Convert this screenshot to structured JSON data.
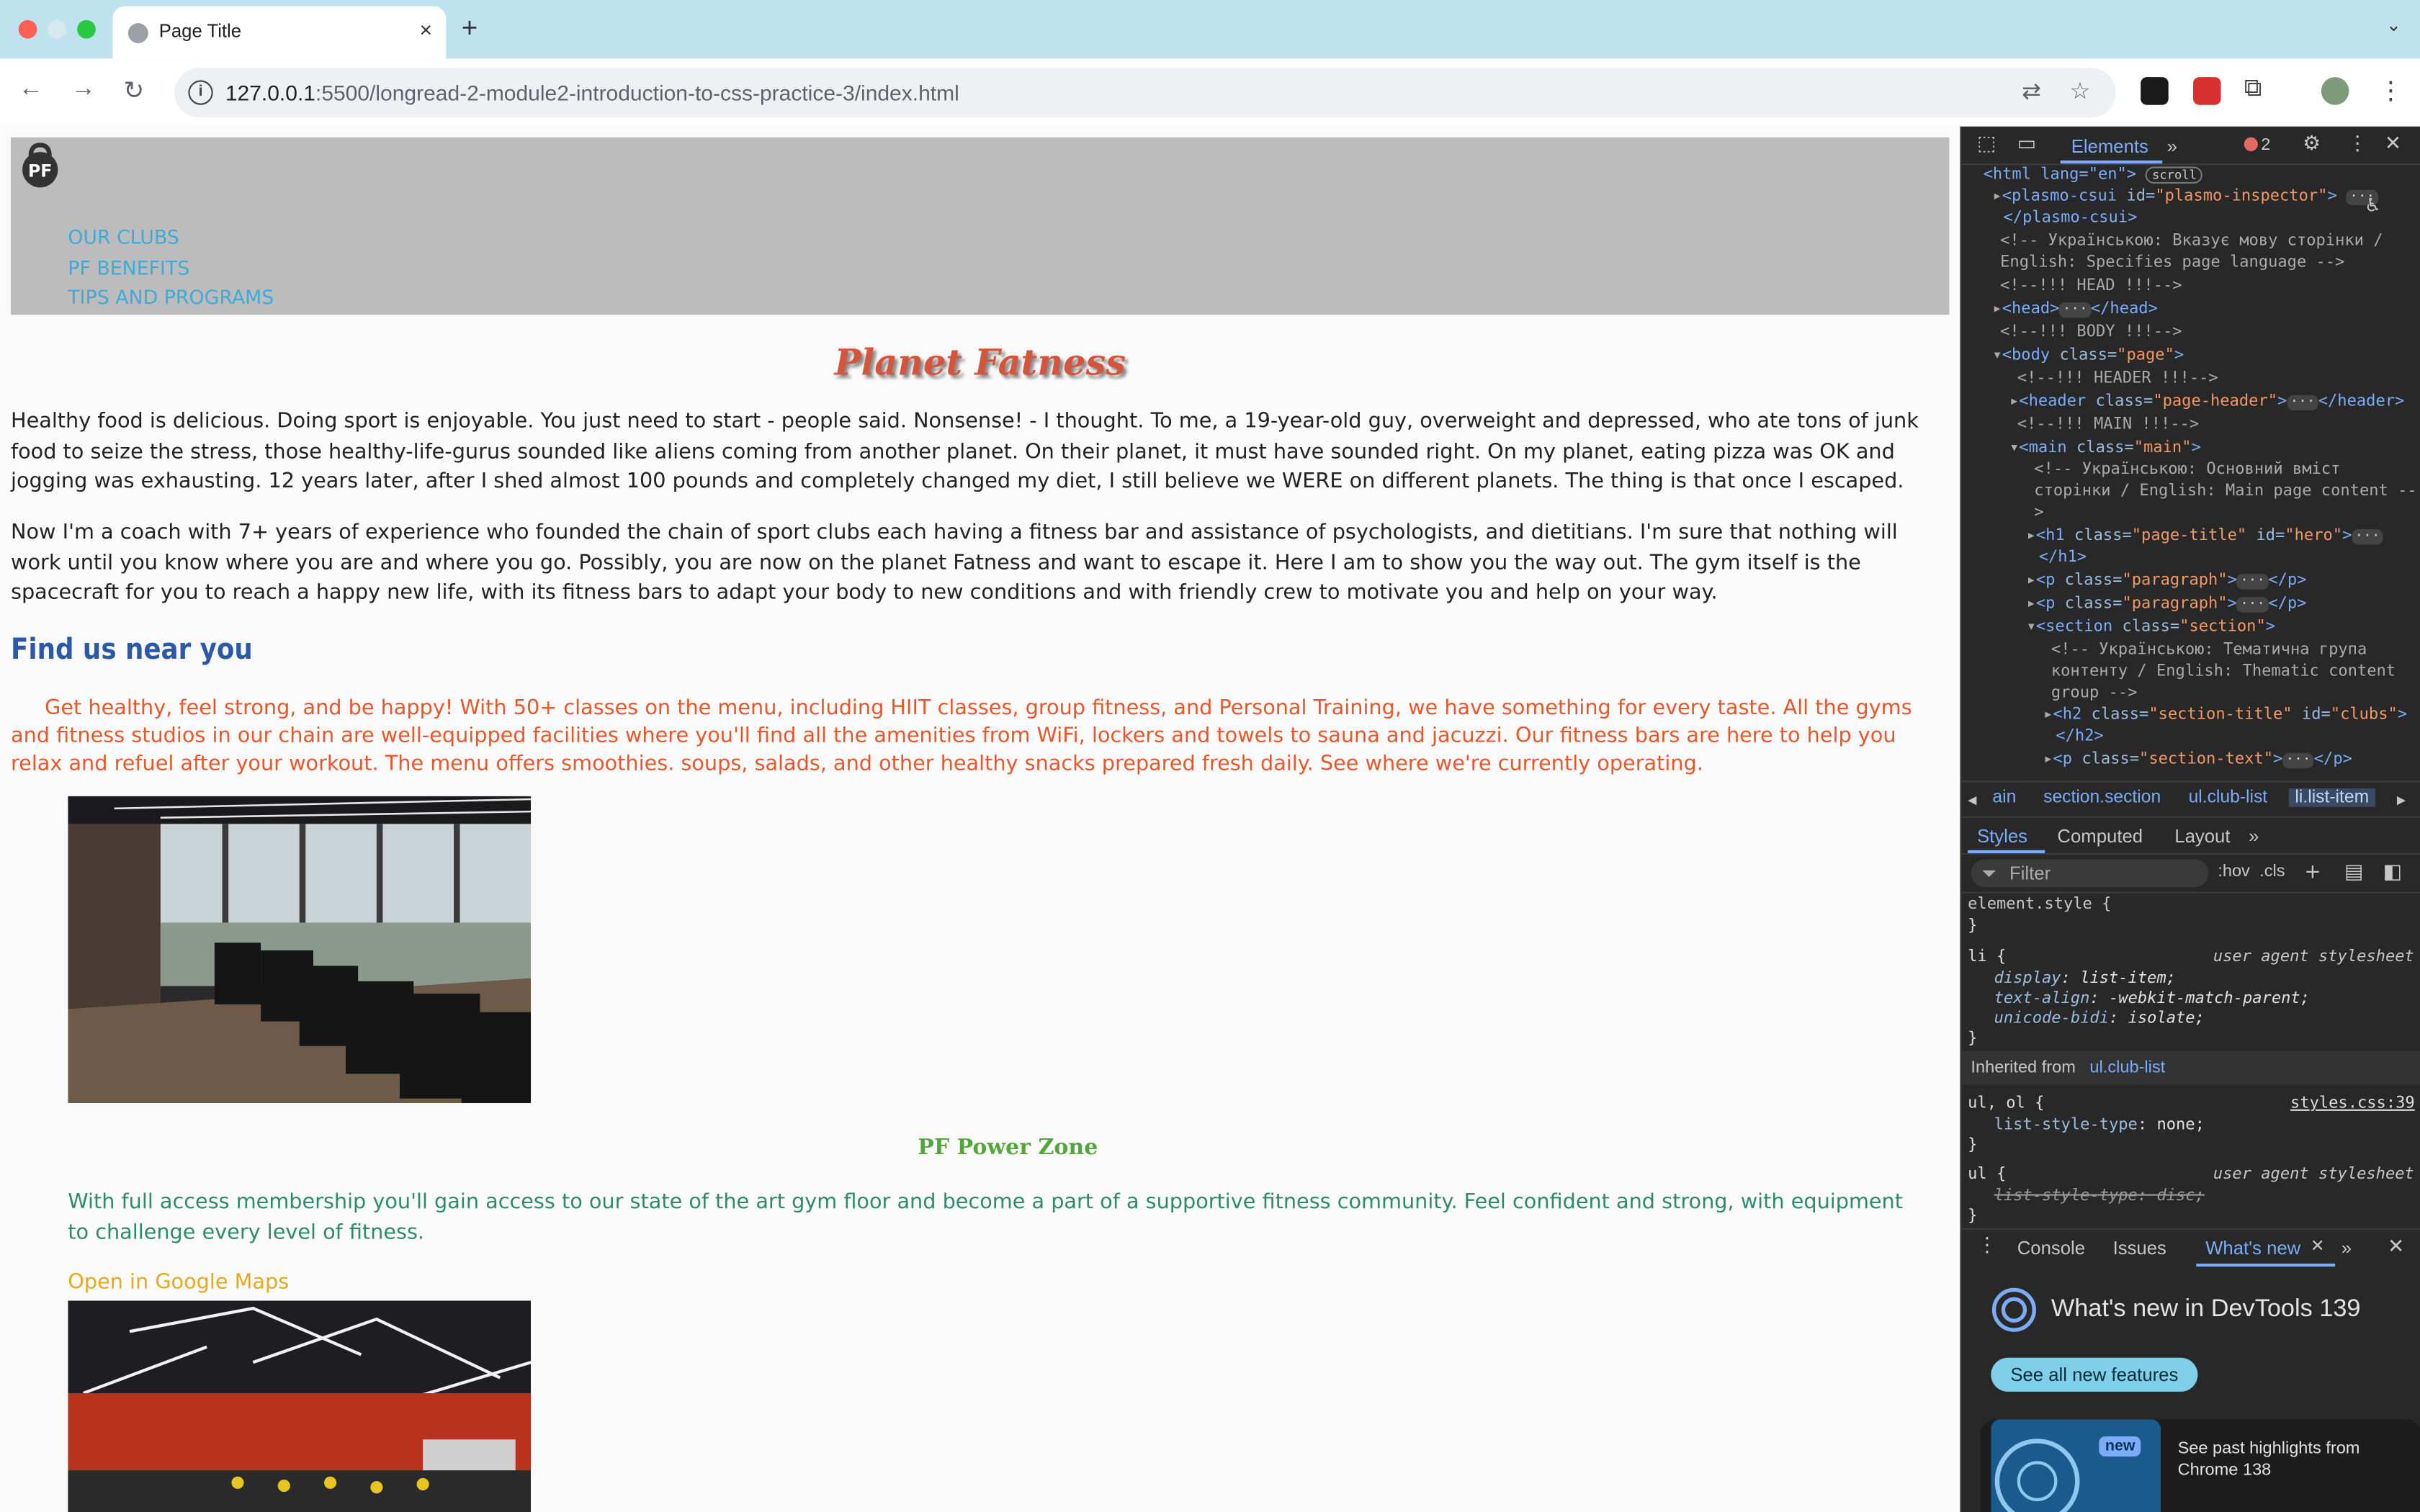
{
  "browser": {
    "tab_title": "Page Title",
    "tab_close": "×",
    "new_tab": "+",
    "tab_menu": "⌄",
    "url_host": "127.0.0.1",
    "url_path": ":5500/longread-2-module2-introduction-to-css-practice-3/index.html",
    "back_icon": "←",
    "forward_icon": "→",
    "reload_icon": "↻",
    "translate_icon": "⇄",
    "star_icon": "☆",
    "puzzle_icon": "⧉",
    "menu_icon": "⋮",
    "colors": {
      "tabstrip": "#bfe3ee",
      "close": "#ff5f57",
      "minimize": "#febc2e",
      "zoom": "#28c840"
    }
  },
  "page": {
    "logo_text": "PF",
    "nav": [
      "OUR CLUBS",
      "PF BENEFITS",
      "TIPS AND PROGRAMS"
    ],
    "hero_title": "Planet Fatness",
    "paragraphs": [
      "Healthy food is delicious. Doing sport is enjoyable. You just need to start - people said. Nonsense! - I thought. To me, a 19-year-old guy, overweight and depressed, who ate tons of junk food to seize the stress, those healthy-life-gurus sounded like aliens coming from another planet. On their planet, it must have sounded right. On my planet, eating pizza was OK and jogging was exhausting. 12 years later, after I shed almost 100 pounds and completely changed my diet, I still believe we WERE on different planets. The thing is that once I escaped.",
      "Now I'm a coach with 7+ years of experience who founded the chain of sport clubs each having a fitness bar and assistance of psychologists, and dietitians. I'm sure that nothing will work until you know where you are and where you go. Possibly, you are now on the planet Fatness and want to escape it. Here I am to show you the way out. The gym itself is the spacecraft for you to reach a happy new life, with its fitness bars to adapt your body to new conditions and with friendly crew to motivate you and help on your way."
    ],
    "section_title": "Find us near you",
    "section_text": "Get healthy, feel strong, and be happy! With 50+ classes on the menu, including HIIT classes, group fitness, and Personal Training, we have something for every taste. All the gyms and fitness studios in our chain are well-equipped facilities where you'll find all the amenities from WiFi, lockers and towels to sauna and jacuzzi. Our fitness bars are here to help you relax and refuel after your workout. The menu offers smoothies. soups, salads, and other healthy snacks prepared fresh daily. See where we're currently operating.",
    "club": {
      "title": "PF Power Zone",
      "text": "With full access membership you'll gain access to our state of the art gym floor and become a part of a supportive fitness community. Feel confident and strong, with equipment to challenge every level of fitness.",
      "maps_link": "Open in Google Maps"
    }
  },
  "devtools": {
    "tabs": {
      "elements": "Elements",
      "more": "»",
      "errors": "2"
    },
    "dom": {
      "l1_tag": "<html lang=\"en\">",
      "l1_badge": "scroll",
      "l2_open": "<plasmo-csui",
      "l2_attr": "id=",
      "l2_val": "\"plasmo-inspector\"",
      "l2_close": ">",
      "l3": "</plasmo-csui>",
      "l4": "<!-- Українською: Вказує мову сторінки /",
      "l5": "English: Specifies page language -->",
      "l6": "<!--!!! HEAD !!!-->",
      "l7a": "<head>",
      "l7b": "</head>",
      "l8": "<!--!!! BODY !!!-->",
      "l9a": "<body",
      "l9b": "class=",
      "l9c": "\"page\"",
      "l9d": ">",
      "l10": "<!--!!! HEADER !!!-->",
      "l11a": "<header",
      "l11b": "class=",
      "l11c": "\"page-header\"",
      "l11d": ">",
      "l11e": "</header>",
      "l12": "<!--!!! MAIN !!!-->",
      "l13a": "<main",
      "l13b": "class=",
      "l13c": "\"main\"",
      "l13d": ">",
      "l14": "<!-- Українською: Основний вміст",
      "l15": "сторінки / English: Main page content --",
      "l16": ">",
      "l17a": "<h1",
      "l17b": "class=",
      "l17c": "\"page-title\"",
      "l17d": "id=",
      "l17e": "\"hero\"",
      "l17f": ">",
      "l18": "</h1>",
      "l19a": "<p",
      "l19b": "class=",
      "l19c": "\"paragraph\"",
      "l19d": ">",
      "l19e": "</p>",
      "l21a": "<section",
      "l21b": "class=",
      "l21c": "\"section\"",
      "l21d": ">",
      "l22": "<!-- Українською: Тематична група",
      "l23": "контенту / English: Thematic content",
      "l24": "group -->",
      "l25a": "<h2",
      "l25b": "class=",
      "l25c": "\"section-title\"",
      "l25d": "id=",
      "l25e": "\"clubs\"",
      "l25f": ">",
      "l26": "</h2>",
      "l27a": "<p",
      "l27b": "class=",
      "l27c": "\"section-text\"",
      "l27d": ">",
      "l27e": "</p>",
      "ellipsis": "···"
    },
    "crumbs": [
      "ain",
      "section.section",
      "ul.club-list",
      "li.list-item"
    ],
    "styles_tabs": [
      "Styles",
      "Computed",
      "Layout"
    ],
    "filter_placeholder": "Filter",
    "hov": ":hov",
    "cls": ".cls",
    "css": {
      "element_style": "element.style {",
      "close": "}",
      "li_sel": "li {",
      "ua": "user agent stylesheet",
      "li_p1": "display",
      "li_v1": "list-item;",
      "li_p2": "text-align",
      "li_v2": "-webkit-match-parent;",
      "li_p3": "unicode-bidi",
      "li_v3": "isolate;",
      "inherited_label": "Inherited from",
      "inherited_sel": "ul.club-list",
      "ulol_sel": "ul, ol {",
      "source": "styles.css:39",
      "ulol_p": "list-style-type",
      "ulol_v": "none;",
      "ul_sel": "ul {",
      "ul_p": "list-style-type",
      "ul_v": "disc;"
    },
    "drawer": {
      "console": "Console",
      "issues": "Issues",
      "whats_new": "What's new",
      "headline": "What's new in DevTools 139",
      "see_all": "See all new features",
      "badge": "new",
      "highlights": "See past highlights from Chrome 138"
    }
  }
}
